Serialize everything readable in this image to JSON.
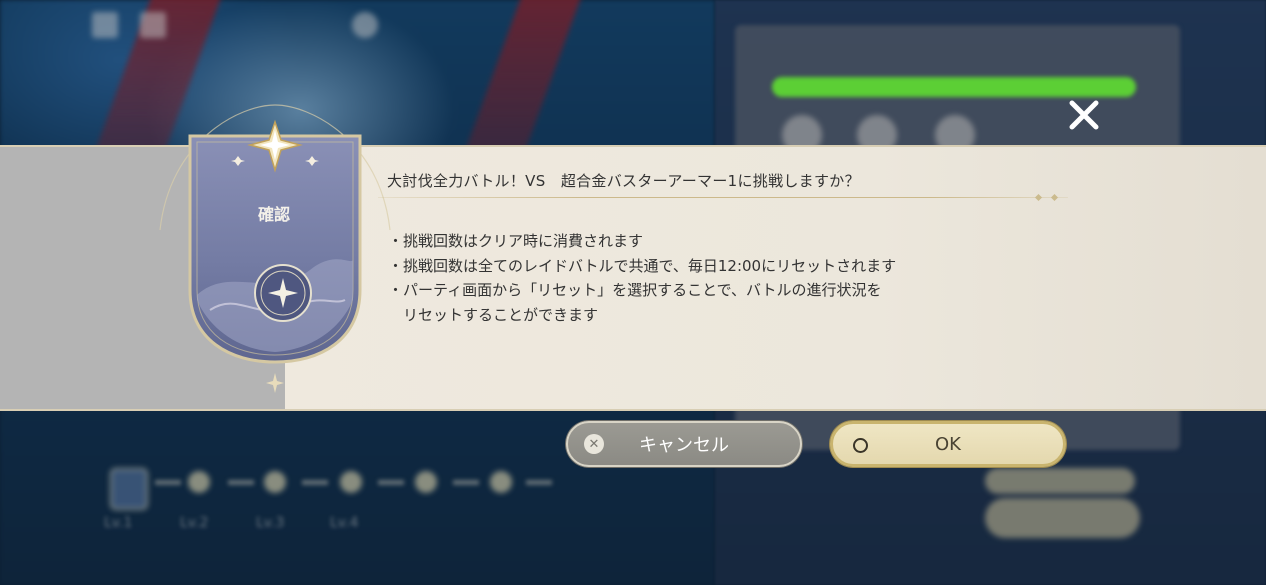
{
  "dialog": {
    "header_label": "確認",
    "title": "大討伐全力バトル！VS　超合金バスターアーマー1に挑戦しますか？",
    "lines": [
      "・挑戦回数はクリア時に消費されます",
      "・挑戦回数は全てのレイドバトルで共通で、毎日12:00にリセットされます",
      "・パーティ画面から「リセット」を選択することで、バトルの進行状況を",
      "　リセットすることができます"
    ],
    "cancel_label": "キャンセル",
    "ok_label": "OK"
  },
  "background": {
    "level_labels": [
      "Lv.1",
      "Lv.2",
      "Lv.3",
      "Lv.4"
    ]
  },
  "colors": {
    "band": "#ebe6dc",
    "band_left": "#b4b4b4",
    "emblem": "#7f86ad",
    "gold": "#c9b46e",
    "progress_green": "#5ccf35"
  },
  "icons": {
    "close": "close-icon",
    "cancel": "x-circle-icon",
    "ok": "circle-icon",
    "emblem": "star-emblem-icon"
  }
}
